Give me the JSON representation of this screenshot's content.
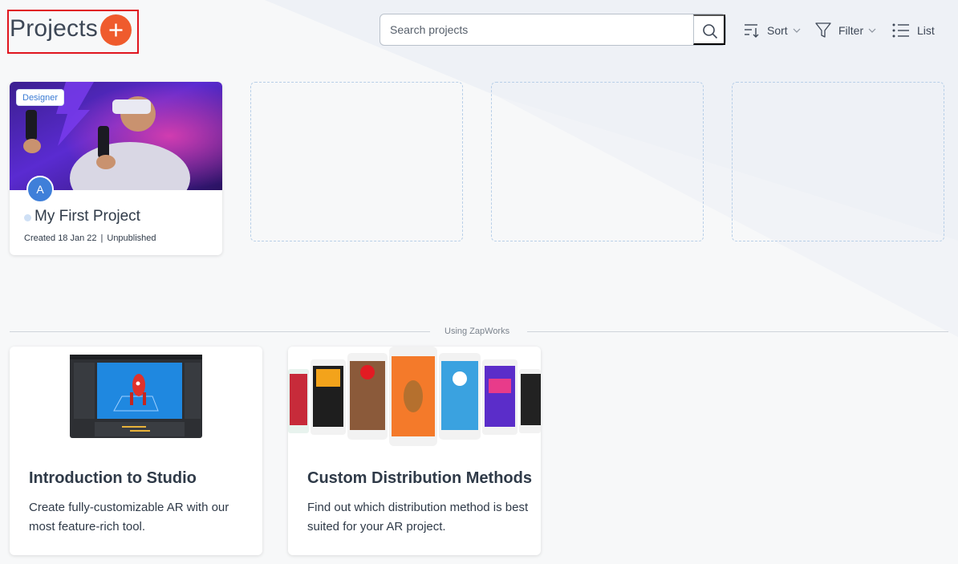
{
  "header": {
    "title": "Projects",
    "add_icon": "plus-icon",
    "search": {
      "placeholder": "Search projects",
      "value": ""
    },
    "sort_label": "Sort",
    "filter_label": "Filter",
    "list_label": "List"
  },
  "projects": [
    {
      "badge": "Designer",
      "avatar_letter": "A",
      "title": "My First Project",
      "created": "Created 18 Jan 22",
      "separator": "|",
      "status": "Unpublished"
    }
  ],
  "section_label": "Using ZapWorks",
  "tutorials": [
    {
      "title": "Introduction to Studio",
      "description": "Create fully-customizable AR with our most feature-rich tool."
    },
    {
      "title": "Custom Distribution Methods",
      "description": "Find out which distribution method is best suited for your AR project."
    }
  ],
  "colors": {
    "accent": "#ef5b2d",
    "highlight": "#e0141e",
    "avatar": "#3f7fd9",
    "placeholder_border": "#b8cfe8"
  }
}
